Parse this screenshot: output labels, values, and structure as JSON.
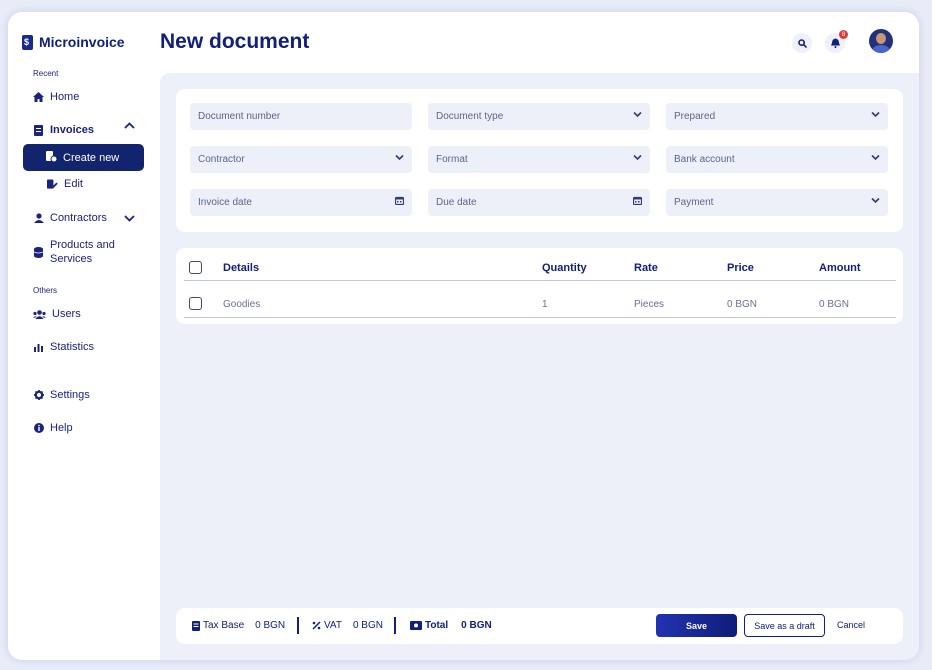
{
  "app": {
    "name": "Microinvoice"
  },
  "sidebar": {
    "recent_label": "Recent",
    "others_label": "Others",
    "items": {
      "home": "Home",
      "invoices": "Invoices",
      "create_new": "Create new",
      "edit": "Edit",
      "contractors": "Contractors",
      "products_line1": "Products and",
      "products_line2": "Services",
      "users": "Users",
      "statistics": "Statistics",
      "settings": "Settings",
      "help": "Help"
    }
  },
  "header": {
    "title": "New document",
    "notification_count": "8"
  },
  "form": {
    "document_number": "Document number",
    "document_type": "Document type",
    "prepared": "Prepared",
    "contractor": "Contractor",
    "format": "Format",
    "bank_account": "Bank account",
    "invoice_date": "Invoice date",
    "due_date": "Due date",
    "payment": "Payment"
  },
  "table": {
    "columns": [
      "Details",
      "Quantity",
      "Rate",
      "Price",
      "Amount"
    ],
    "rows": [
      {
        "details": "Goodies",
        "quantity": "1",
        "rate": "Pieces",
        "price": "0 BGN",
        "amount": "0 BGN"
      }
    ]
  },
  "footer": {
    "tax_base_label": "Tax Base",
    "tax_base_value": "0 BGN",
    "vat_label": "VAT",
    "vat_value": "0 BGN",
    "total_label": "Total",
    "total_value": "0 BGN",
    "save": "Save",
    "save_draft": "Save as a draft",
    "cancel": "Cancel"
  },
  "colors": {
    "primary": "#12207c",
    "accent_start": "#2233b0",
    "background": "#eef0f9",
    "badge": "#e53935"
  }
}
